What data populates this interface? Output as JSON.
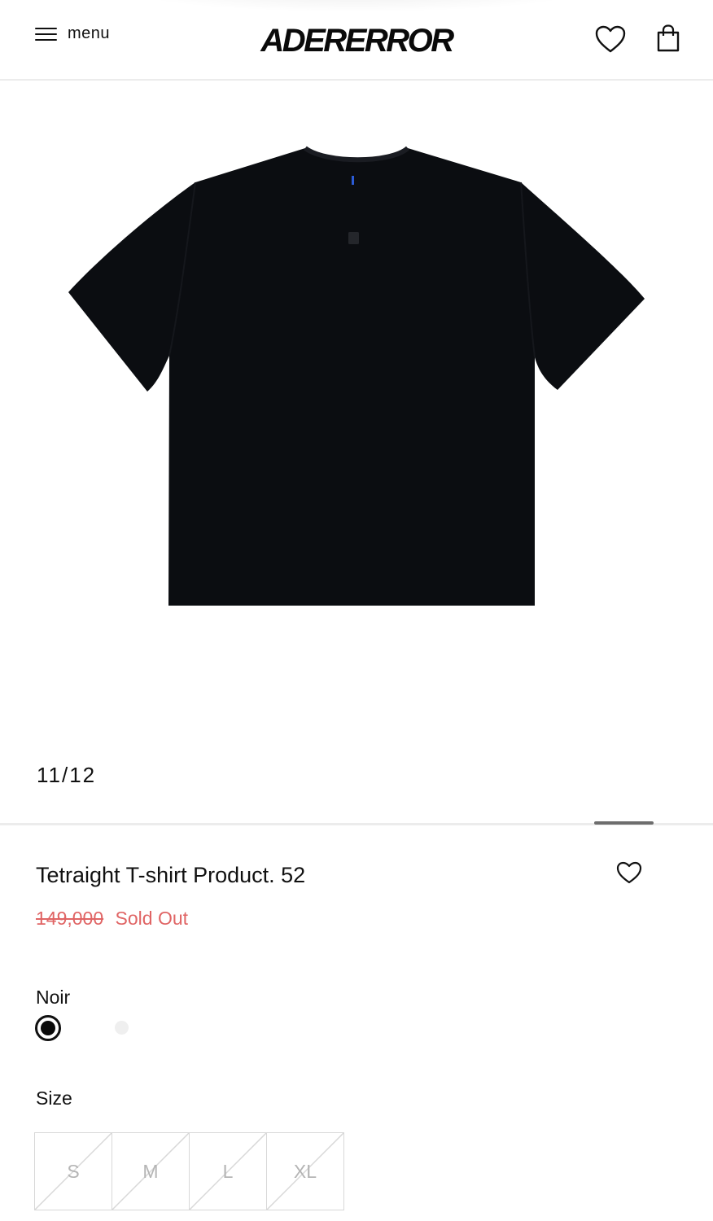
{
  "header": {
    "menu_label": "menu",
    "logo_text": "ADERERROR",
    "icons": [
      "hamburger-icon",
      "heart-icon",
      "shopping-bag-icon"
    ]
  },
  "gallery": {
    "counter": "11/12",
    "image_alt": "black t-shirt",
    "current_index": 11,
    "total": 12
  },
  "product": {
    "title": "Tetraight T-shirt Product. 52",
    "original_price": "149,000",
    "status": "Sold Out",
    "price_color": "#e06565"
  },
  "color": {
    "selected_label": "Noir",
    "swatches": [
      {
        "name": "Noir",
        "hex": "#0a0a0a",
        "selected": true
      },
      {
        "name": "",
        "hex": "#efefef",
        "selected": false
      }
    ]
  },
  "size": {
    "label": "Size",
    "options": [
      "S",
      "M",
      "L",
      "XL"
    ],
    "all_unavailable": true
  }
}
